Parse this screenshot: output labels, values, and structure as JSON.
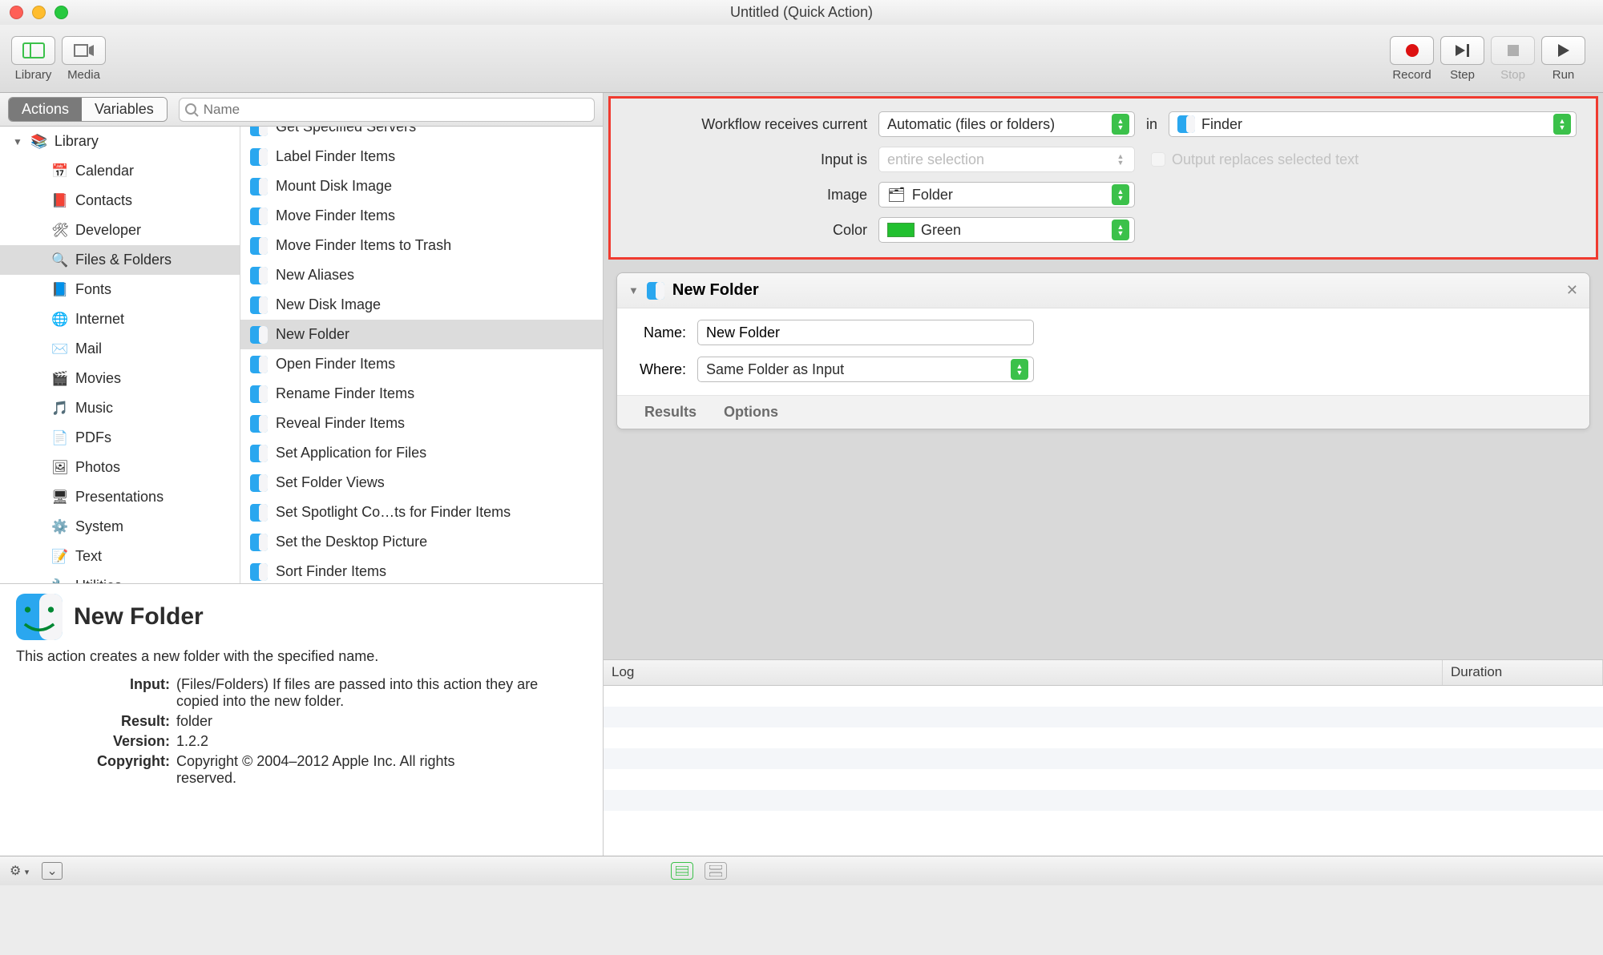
{
  "window": {
    "title": "Untitled (Quick Action)"
  },
  "toolbar": {
    "library_label": "Library",
    "media_label": "Media",
    "record_label": "Record",
    "step_label": "Step",
    "stop_label": "Stop",
    "run_label": "Run"
  },
  "left_tabs": {
    "actions": "Actions",
    "variables": "Variables"
  },
  "search": {
    "placeholder": "Name"
  },
  "library": {
    "root": "Library",
    "cats_selected_index": 4,
    "cats": [
      {
        "label": "Calendar",
        "glyph": "📅"
      },
      {
        "label": "Contacts",
        "glyph": "📕"
      },
      {
        "label": "Developer",
        "glyph": "🛠"
      },
      {
        "label": "Files & Folders",
        "glyph": "🔍"
      },
      {
        "label": "Fonts",
        "glyph": "📘"
      },
      {
        "label": "Internet",
        "glyph": "🌐"
      },
      {
        "label": "Mail",
        "glyph": "✉️"
      },
      {
        "label": "Movies",
        "glyph": "🎬"
      },
      {
        "label": "Music",
        "glyph": "🎵"
      },
      {
        "label": "PDFs",
        "glyph": "📄"
      },
      {
        "label": "Photos",
        "glyph": "🖼"
      },
      {
        "label": "Presentations",
        "glyph": "🖥"
      },
      {
        "label": "System",
        "glyph": "⚙️"
      },
      {
        "label": "Text",
        "glyph": "📝"
      },
      {
        "label": "Utilities",
        "glyph": "🔧"
      }
    ]
  },
  "actions": {
    "selected_index": 7,
    "items": [
      "Get Specified Servers",
      "Label Finder Items",
      "Mount Disk Image",
      "Move Finder Items",
      "Move Finder Items to Trash",
      "New Aliases",
      "New Disk Image",
      "New Folder",
      "Open Finder Items",
      "Rename Finder Items",
      "Reveal Finder Items",
      "Set Application for Files",
      "Set Folder Views",
      "Set Spotlight Co…ts for Finder Items",
      "Set the Desktop Picture",
      "Sort Finder Items"
    ]
  },
  "desc": {
    "title": "New Folder",
    "summary": "This action creates a new folder with the specified name.",
    "input_k": "Input:",
    "input_v": "(Files/Folders) If files are passed into this action they are copied into the new folder.",
    "result_k": "Result:",
    "result_v": "folder",
    "version_k": "Version:",
    "version_v": "1.2.2",
    "copyright_k": "Copyright:",
    "copyright_v": "Copyright © 2004–2012 Apple Inc.  All rights reserved."
  },
  "config": {
    "receives_label": "Workflow receives current",
    "receives_value": "Automatic (files or folders)",
    "in_label": "in",
    "in_value": "Finder",
    "input_is_label": "Input is",
    "input_is_value": "entire selection",
    "output_replaces_label": "Output replaces selected text",
    "image_label": "Image",
    "image_value": "Folder",
    "color_label": "Color",
    "color_value": "Green"
  },
  "step": {
    "title": "New Folder",
    "name_label": "Name:",
    "name_value": "New Folder",
    "where_label": "Where:",
    "where_value": "Same Folder as Input",
    "results_tab": "Results",
    "options_tab": "Options"
  },
  "log": {
    "col_log": "Log",
    "col_duration": "Duration"
  }
}
